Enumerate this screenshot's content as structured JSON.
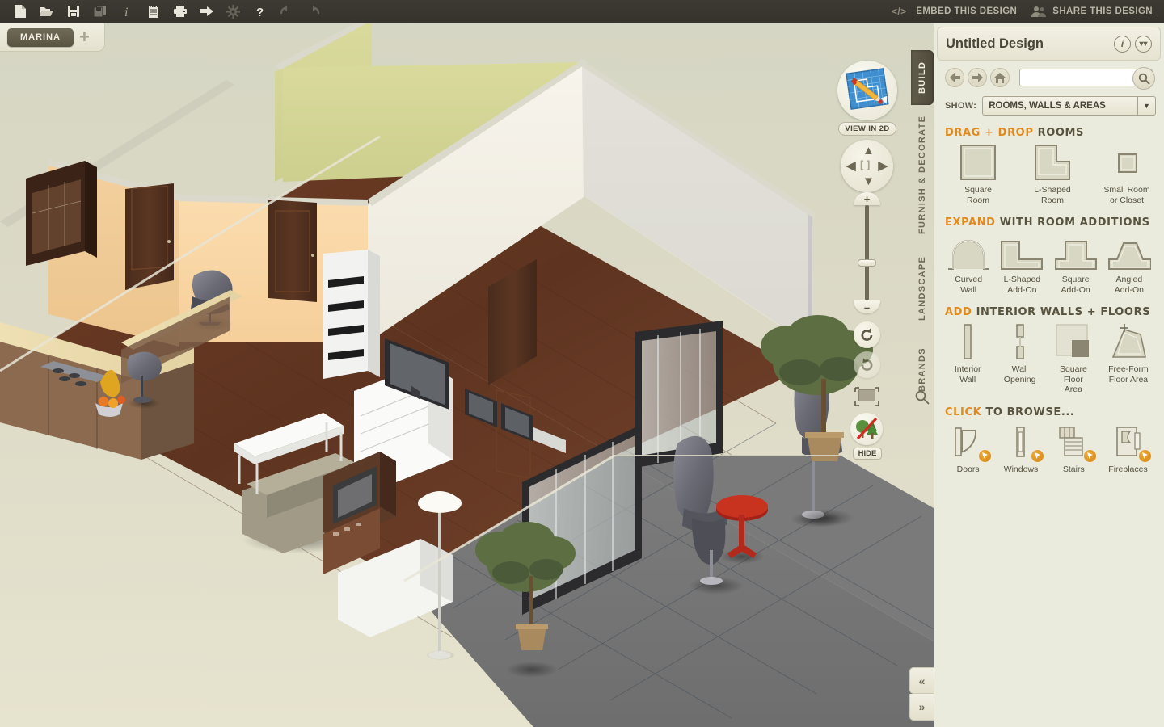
{
  "toolbar": {
    "icons": [
      {
        "name": "new-document-icon",
        "title": "New"
      },
      {
        "name": "open-folder-icon",
        "title": "Open"
      },
      {
        "name": "save-icon",
        "title": "Save"
      },
      {
        "name": "save-as-icon",
        "title": "Save As",
        "disabled": true
      },
      {
        "name": "info-icon",
        "title": "Info"
      },
      {
        "name": "notes-icon",
        "title": "Notes"
      },
      {
        "name": "print-icon",
        "title": "Print"
      },
      {
        "name": "export-icon",
        "title": "Export"
      },
      {
        "name": "settings-gear-icon",
        "title": "Settings",
        "disabled": true
      },
      {
        "name": "help-icon",
        "title": "Help"
      },
      {
        "name": "undo-icon",
        "title": "Undo",
        "disabled": true
      },
      {
        "name": "redo-icon",
        "title": "Redo",
        "disabled": true
      }
    ],
    "embed_label": "EMBED THIS DESIGN",
    "share_label": "SHARE THIS DESIGN"
  },
  "tabbar": {
    "document_tab": "MARINA",
    "add_tab": "+"
  },
  "viewport": {
    "view_2d_label": "VIEW IN 2D",
    "hide_label": "HIDE",
    "zoom_in": "+",
    "zoom_out": "–"
  },
  "vertical_tabs": [
    {
      "label": "BUILD",
      "active": true
    },
    {
      "label": "FURNISH & DECORATE",
      "active": false
    },
    {
      "label": "LANDSCAPE",
      "active": false
    },
    {
      "label": "BRANDS",
      "active": false
    }
  ],
  "panel": {
    "title": "Untitled Design",
    "search_value": "",
    "search_placeholder": "",
    "show_label": "SHOW:",
    "show_value": "ROOMS, WALLS & AREAS",
    "sections": [
      {
        "title_accent": "DRAG + DROP",
        "title_rest": "ROOMS",
        "items": [
          {
            "icon": "square-room-icon",
            "caption": "Square\nRoom"
          },
          {
            "icon": "l-shaped-room-icon",
            "caption": "L-Shaped\nRoom"
          },
          {
            "icon": "small-room-icon",
            "caption": "Small Room\nor Closet"
          }
        ]
      },
      {
        "title_accent": "EXPAND",
        "title_rest": "WITH ROOM ADDITIONS",
        "items": [
          {
            "icon": "curved-wall-icon",
            "caption": "Curved\nWall"
          },
          {
            "icon": "l-shaped-addon-icon",
            "caption": "L-Shaped\nAdd-On"
          },
          {
            "icon": "square-addon-icon",
            "caption": "Square\nAdd-On"
          },
          {
            "icon": "angled-addon-icon",
            "caption": "Angled\nAdd-On"
          }
        ]
      },
      {
        "title_accent": "ADD",
        "title_rest": "INTERIOR WALLS + FLOORS",
        "items": [
          {
            "icon": "interior-wall-icon",
            "caption": "Interior\nWall"
          },
          {
            "icon": "wall-opening-icon",
            "caption": "Wall\nOpening"
          },
          {
            "icon": "square-floor-area-icon",
            "caption": "Square Floor\nArea"
          },
          {
            "icon": "free-form-floor-area-icon",
            "caption": "Free-Form\nFloor Area"
          }
        ]
      },
      {
        "title_accent": "CLICK",
        "title_rest": "TO BROWSE...",
        "items": [
          {
            "icon": "doors-icon",
            "caption": "Doors",
            "badge": true
          },
          {
            "icon": "windows-icon",
            "caption": "Windows",
            "badge": true
          },
          {
            "icon": "stairs-icon",
            "caption": "Stairs",
            "badge": true
          },
          {
            "icon": "fireplaces-icon",
            "caption": "Fireplaces",
            "badge": true
          }
        ]
      }
    ],
    "collapse_left": "«",
    "collapse_right": "»"
  },
  "colors": {
    "accent_orange": "#E08A1E",
    "toolbar_dark": "#35332c",
    "panel_cream": "#EAEADD",
    "tab_olive": "#595442",
    "canvas_bg": "#DCDAC6"
  }
}
